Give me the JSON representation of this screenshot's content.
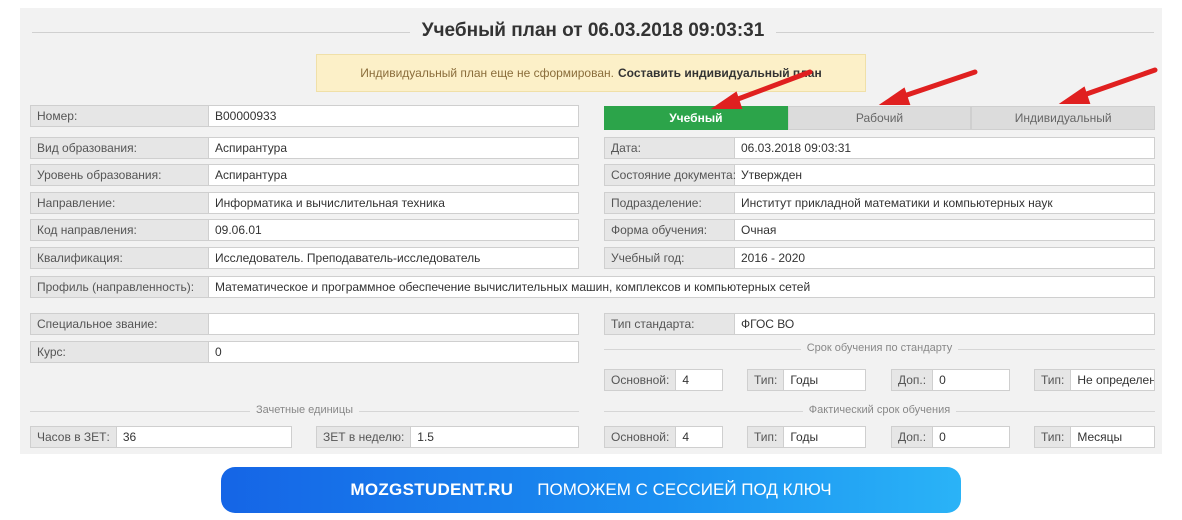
{
  "title": "Учебный план от 06.03.2018 09:03:31",
  "notice": {
    "text": "Индивидуальный план еще не сформирован.",
    "link": "Составить индивидуальный план"
  },
  "tabs": [
    {
      "label": "Учебный",
      "active": true
    },
    {
      "label": "Рабочий",
      "active": false
    },
    {
      "label": "Индивидуальный",
      "active": false
    }
  ],
  "left_fields": [
    {
      "label": "Номер:",
      "value": "В00000933"
    },
    {
      "label": "Вид образования:",
      "value": "Аспирантура"
    },
    {
      "label": "Уровень образования:",
      "value": "Аспирантура"
    },
    {
      "label": "Направление:",
      "value": "Информатика и вычислительная техника"
    },
    {
      "label": "Код направления:",
      "value": "09.06.01"
    },
    {
      "label": "Квалификация:",
      "value": "Исследователь. Преподаватель-исследователь"
    }
  ],
  "right_fields": [
    {
      "label": "Дата:",
      "value": "06.03.2018 09:03:31"
    },
    {
      "label": "Состояние документа:",
      "value": "Утвержден"
    },
    {
      "label": "Подразделение:",
      "value": "Институт прикладной математики и компьютерных наук"
    },
    {
      "label": "Форма обучения:",
      "value": "Очная"
    },
    {
      "label": "Учебный год:",
      "value": "2016 - 2020"
    }
  ],
  "profile": {
    "label": "Профиль (направленность):",
    "value": "Математическое и программное обеспечение вычислительных машин, комплексов и компьютерных сетей"
  },
  "special_title": {
    "label": "Специальное звание:",
    "value": ""
  },
  "course": {
    "label": "Курс:",
    "value": "0"
  },
  "standard_type": {
    "label": "Тип стандарта:",
    "value": "ФГОС ВО"
  },
  "standard_term": {
    "heading": "Срок обучения по стандарту",
    "main": {
      "label": "Основной:",
      "value": "4"
    },
    "type1": {
      "label": "Тип:",
      "value": "Годы"
    },
    "extra": {
      "label": "Доп.:",
      "value": "0"
    },
    "type2": {
      "label": "Тип:",
      "value": "Не определен"
    }
  },
  "credits": {
    "heading": "Зачетные единицы",
    "hours": {
      "label": "Часов в ЗЕТ:",
      "value": "36"
    },
    "per_week": {
      "label": "ЗЕТ в неделю:",
      "value": "1.5"
    }
  },
  "actual_term": {
    "heading": "Фактический срок обучения",
    "main": {
      "label": "Основной:",
      "value": "4"
    },
    "type1": {
      "label": "Тип:",
      "value": "Годы"
    },
    "extra": {
      "label": "Доп.:",
      "value": "0"
    },
    "type2": {
      "label": "Тип:",
      "value": "Месяцы"
    }
  },
  "banner": {
    "brand": "MOZGSTUDENT.RU",
    "slogan": "ПОМОЖЕМ С СЕССИЕЙ ПОД КЛЮЧ"
  },
  "colors": {
    "active_tab": "#2ca44a",
    "notice_bg": "#fcf0c8",
    "arrow": "#e02020",
    "banner_start": "#1565e6",
    "banner_end": "#2ab3f7"
  }
}
